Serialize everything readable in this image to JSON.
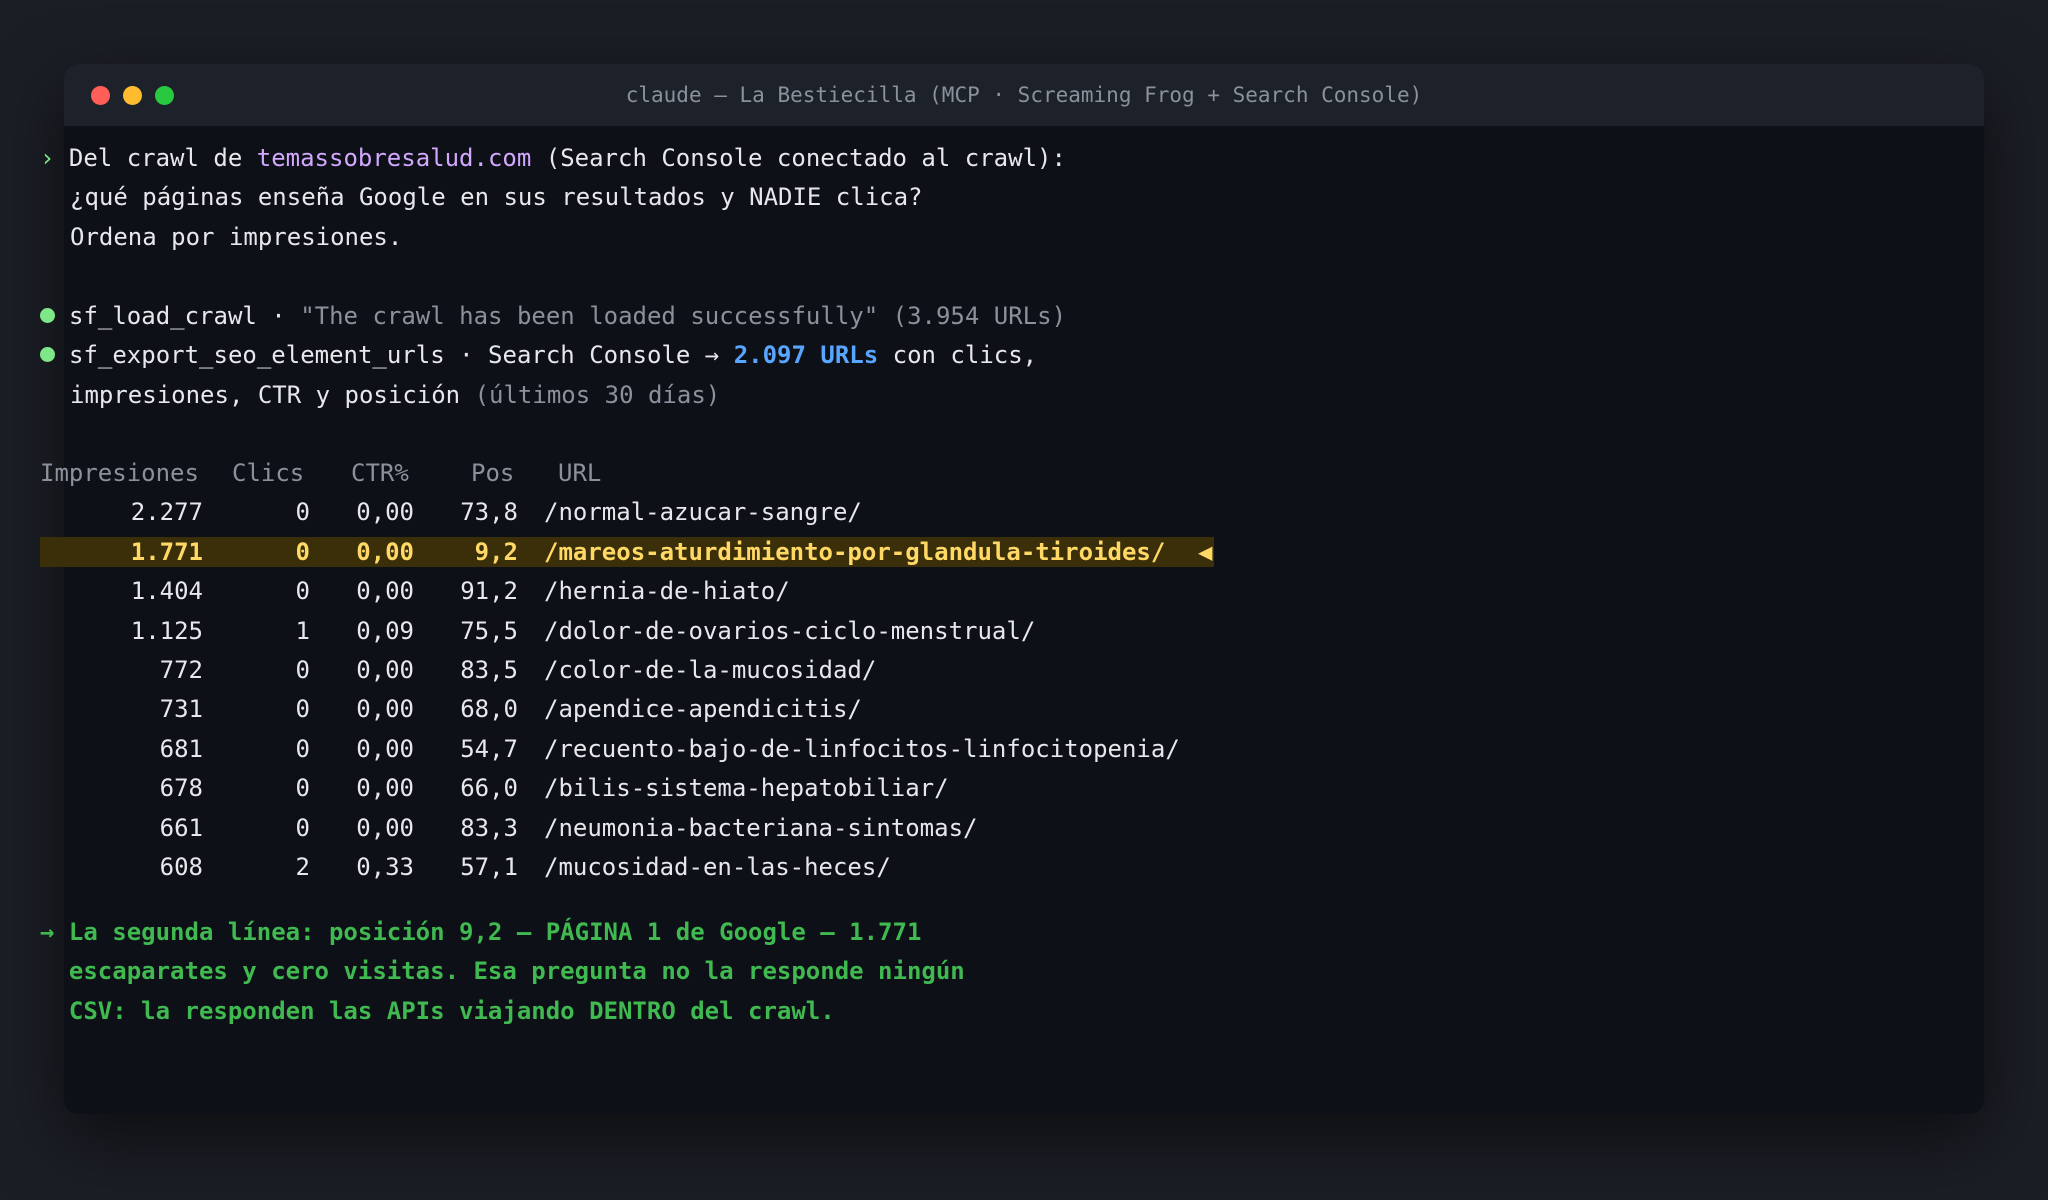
{
  "window": {
    "title": "claude — La Bestiecilla (MCP · Screaming Frog + Search Console)"
  },
  "prompt": {
    "marker": "›",
    "line1_pre": "Del crawl de ",
    "domain": "temassobresalud.com",
    "line1_post": " (Search Console conectado al crawl):",
    "line2": "¿qué páginas enseña Google en sus resultados y NADIE clica?",
    "line3": "Ordena por impresiones."
  },
  "tools": [
    {
      "name": "sf_load_crawl",
      "sep": " · ",
      "message": "\"The crawl has been loaded successfully\" (3.954 URLs)"
    },
    {
      "name": "sf_export_seo_element_urls",
      "sep": " · ",
      "pre": "Search Console → ",
      "highlight": "2.097 URLs",
      "post": " con clics,",
      "line2": "impresiones, CTR y posición ",
      "line2_dim": "(últimos 30 días)"
    }
  ],
  "table": {
    "headers": [
      "Impresiones",
      "Clics",
      "CTR%",
      "Pos",
      "URL"
    ],
    "rows": [
      {
        "impresiones": "2.277",
        "clics": "0",
        "ctr": "0,00",
        "pos": "73,8",
        "url": "/normal-azucar-sangre/",
        "marker": ""
      },
      {
        "impresiones": "1.771",
        "clics": "0",
        "ctr": "0,00",
        "pos": "9,2",
        "url": "/mareos-aturdimiento-por-glandula-tiroides/",
        "marker": "◀"
      },
      {
        "impresiones": "1.404",
        "clics": "0",
        "ctr": "0,00",
        "pos": "91,2",
        "url": "/hernia-de-hiato/",
        "marker": ""
      },
      {
        "impresiones": "1.125",
        "clics": "1",
        "ctr": "0,09",
        "pos": "75,5",
        "url": "/dolor-de-ovarios-ciclo-menstrual/",
        "marker": ""
      },
      {
        "impresiones": "772",
        "clics": "0",
        "ctr": "0,00",
        "pos": "83,5",
        "url": "/color-de-la-mucosidad/",
        "marker": ""
      },
      {
        "impresiones": "731",
        "clics": "0",
        "ctr": "0,00",
        "pos": "68,0",
        "url": "/apendice-apendicitis/",
        "marker": ""
      },
      {
        "impresiones": "681",
        "clics": "0",
        "ctr": "0,00",
        "pos": "54,7",
        "url": "/recuento-bajo-de-linfocitos-linfocitopenia/",
        "marker": ""
      },
      {
        "impresiones": "678",
        "clics": "0",
        "ctr": "0,00",
        "pos": "66,0",
        "url": "/bilis-sistema-hepatobiliar/",
        "marker": ""
      },
      {
        "impresiones": "661",
        "clics": "0",
        "ctr": "0,00",
        "pos": "83,3",
        "url": "/neumonia-bacteriana-sintomas/",
        "marker": ""
      },
      {
        "impresiones": "608",
        "clics": "2",
        "ctr": "0,33",
        "pos": "57,1",
        "url": "/mucosidad-en-las-heces/",
        "marker": ""
      }
    ],
    "highlighted_row": 1
  },
  "conclusion": {
    "line1": "→ La segunda línea: posición 9,2 — PÁGINA 1 de Google — 1.771",
    "line2": "  escaparates y cero visitas. Esa pregunta no la responde ningún",
    "line3": "  CSV: la responden las APIs viajando DENTRO del crawl."
  },
  "colors": {
    "background": "#1b1e25",
    "terminal": "#0d1016",
    "prompt_green": "#7ee787",
    "domain_purple": "#d2a8ff",
    "count_blue": "#58a6ff",
    "highlight_yellow": "#ffd866",
    "conclusion_green": "#3fb950"
  }
}
